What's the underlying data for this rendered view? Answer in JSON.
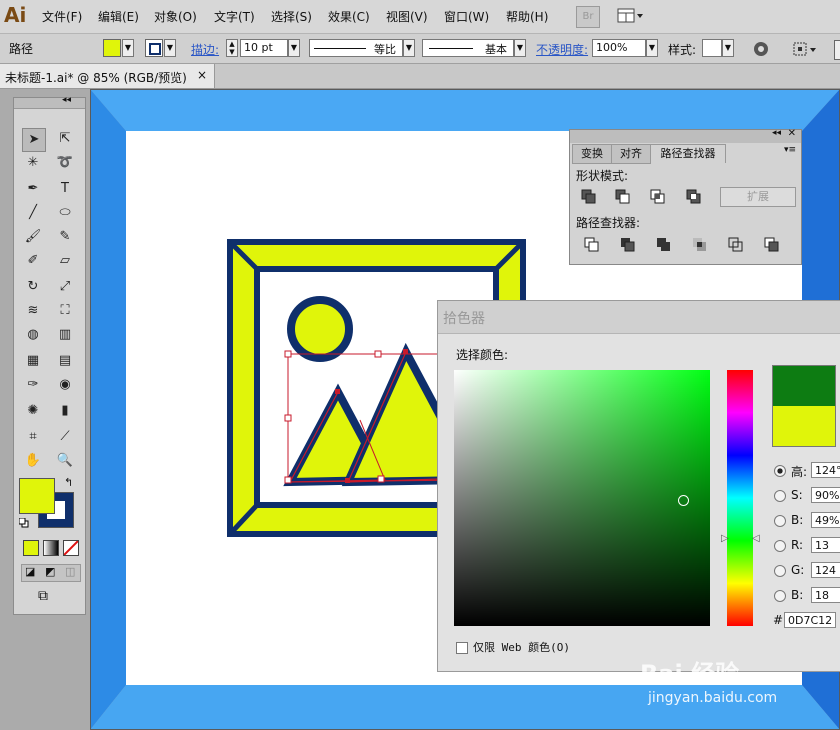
{
  "app": {
    "logo": "Ai"
  },
  "menu": [
    "文件(F)",
    "编辑(E)",
    "对象(O)",
    "文字(T)",
    "选择(S)",
    "效果(C)",
    "视图(V)",
    "窗口(W)",
    "帮助(H)"
  ],
  "menubar": {
    "bridge_label": "Br"
  },
  "control": {
    "selection_label": "路径",
    "stroke_label": "描边:",
    "stroke_value": "10 pt",
    "profile_label": "等比",
    "brush_label": "基本",
    "opacity_label": "不透明度:",
    "opacity_value": "100%",
    "style_label": "样式:"
  },
  "document": {
    "tab_title": "未标题-1.ai* @ 85% (RGB/预览)",
    "close": "×"
  },
  "pathfinder": {
    "tabs": [
      "变换",
      "对齐",
      "路径查找器"
    ],
    "shape_modes_label": "形状模式:",
    "expand_label": "扩展",
    "pathfinders_label": "路径查找器:"
  },
  "color_picker": {
    "title": "拾色器",
    "select_color_label": "选择颜色:",
    "H": {
      "label": "高:",
      "value": "124°"
    },
    "S": {
      "label": "S:",
      "value": "90%"
    },
    "B": {
      "label": "B:",
      "value": "49%"
    },
    "R": {
      "label": "R:",
      "value": "13"
    },
    "G": {
      "label": "G:",
      "value": "124"
    },
    "Bl": {
      "label": "B:",
      "value": "18"
    },
    "hex_label": "#",
    "hex_value": "0D7C12",
    "web_only_label": "仅限 Web 颜色(O)",
    "new_color": "#0d7c12",
    "old_color": "#e0f50a"
  },
  "colors": {
    "fill": "#e0f50a",
    "stroke": "#0f2f6b",
    "artboard_frame": "#3a9bea"
  },
  "watermark": {
    "brand": "Bai 经验",
    "url": "jingyan.baidu.com"
  }
}
